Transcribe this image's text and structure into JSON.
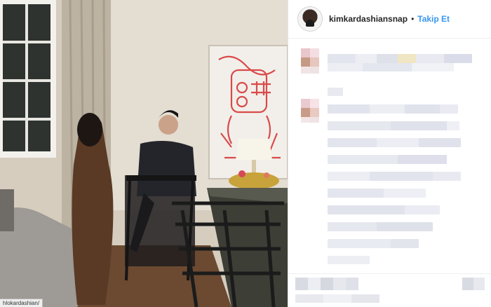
{
  "post": {
    "username": "kimkardashiansnap",
    "separator": "•",
    "follow_label": "Takip Et"
  },
  "photo": {
    "source_url": "hlokardashian/"
  },
  "icons": {
    "avatar": "profile-avatar",
    "comment_avatar": "blurred-avatar"
  },
  "colors": {
    "follow": "#3897f0",
    "username": "#262626",
    "blur_tone": "#dfe1ec"
  }
}
